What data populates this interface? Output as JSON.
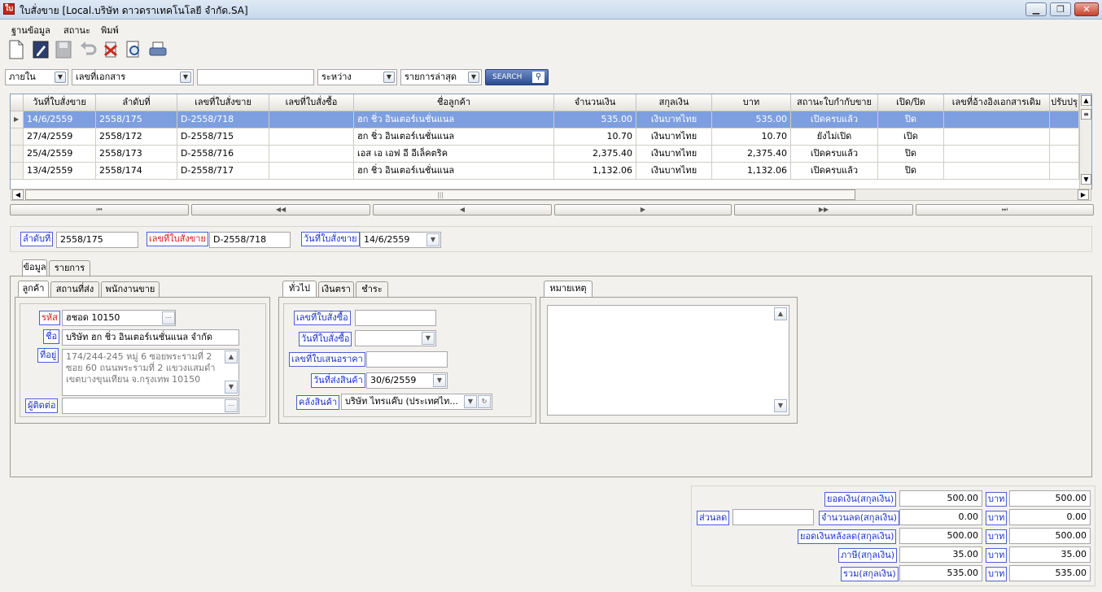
{
  "window": {
    "title": "ใบสั่งขาย [Local.บริษัท ดาวดราเทคโนโลยี จำกัด.SA]",
    "app_icon": "ใบ"
  },
  "menu": [
    "ฐานข้อมูล",
    "สถานะ",
    "พิมพ์"
  ],
  "search": {
    "scope": "ภายใน",
    "field": "เลขที่เอกสาร",
    "text": "",
    "operator": "ระหว่าง",
    "order": "รายการล่าสุด",
    "button": "SEARCH"
  },
  "grid": {
    "headers": [
      "วันที่ใบสั่งขาย",
      "ลำดับที่",
      "เลขที่ใบสั่งขาย",
      "เลขที่ใบสั่งซื้อ",
      "ชื่อลูกค้า",
      "จำนวนเงิน",
      "สกุลเงิน",
      "บาท",
      "สถานะใบกำกับขาย",
      "เปิด/ปิด",
      "เลขที่อ้างอิงเอกสารเดิม",
      "ปรับปรุ"
    ],
    "rows": [
      [
        "14/6/2559",
        "2558/175",
        "D-2558/718",
        "",
        "ฮก ชิ่ว อินเตอร์เนชั่นแนล",
        "535.00",
        "เงินบาทไทย",
        "535.00",
        "เปิดครบแล้ว",
        "ปิด",
        "",
        ""
      ],
      [
        "27/4/2559",
        "2558/172",
        "D-2558/715",
        "",
        "ฮก ชิ่ว อินเตอร์เนชั่นแนล",
        "10.70",
        "เงินบาทไทย",
        "10.70",
        "ยังไม่เปิด",
        "เปิด",
        "",
        ""
      ],
      [
        "25/4/2559",
        "2558/173",
        "D-2558/716",
        "",
        "เอส เอ เอฟ อี อีเล็คตริค",
        "2,375.40",
        "เงินบาทไทย",
        "2,375.40",
        "เปิดครบแล้ว",
        "ปิด",
        "",
        ""
      ],
      [
        "13/4/2559",
        "2558/174",
        "D-2558/717",
        "",
        "ฮก ชิ่ว อินเตอร์เนชั่นแนล",
        "1,132.06",
        "เงินบาทไทย",
        "1,132.06",
        "เปิดครบแล้ว",
        "ปิด",
        "",
        ""
      ]
    ]
  },
  "nav": [
    "first-icon",
    "fast-prev-icon",
    "prev-icon",
    "next-icon",
    "fast-next-icon",
    "last-icon"
  ],
  "doc": {
    "seq_label": "ลำดับที่",
    "seq": "2558/175",
    "so_label": "เลขที่ใบสั่งขาย",
    "so": "D-2558/718",
    "date_label": "วันที่ใบสั่งขาย",
    "date": "14/6/2559"
  },
  "tabs_main": [
    "ข้อมูล",
    "รายการ"
  ],
  "tabs_customer": [
    "ลูกค้า",
    "สถานที่ส่ง",
    "พนักงานขาย"
  ],
  "customer": {
    "code_label": "รหัส",
    "code": "ฮชอด 10150",
    "name_label": "ชื่อ",
    "name": "บริษัท ฮก ชิ่ว อินเตอร์เนชั่นแนล จำกัด",
    "addr_label": "ที่อยู่",
    "addr1": "174/244-245  หมู่ 6  ซอยพระรามที่ 2",
    "addr2": "ซอย 60  ถนนพระรามที่ 2 แขวงแสมดำ",
    "addr3": "เขตบางขุนเทียน จ.กรุงเทพ 10150",
    "contact_label": "ผู้ติดต่อ",
    "contact": ""
  },
  "tabs_general": [
    "ทั่วไป",
    "เงินตรา",
    "ชำระ"
  ],
  "general": {
    "po_label": "เลขที่ใบสั่งซื้อ",
    "po": "",
    "po_date_label": "วันที่ใบสั่งซื้อ",
    "po_date": "",
    "quote_label": "เลขที่ใบเสนอราคา",
    "quote": "",
    "ship_date_label": "วันที่ส่งสินค้า",
    "ship_date": "30/6/2559",
    "warehouse_label": "คลังสินค้า",
    "warehouse": "บริษัท ไทรแค๊บ (ประเทศไท..."
  },
  "notes": {
    "tab": "หมายเหตุ",
    "text": ""
  },
  "totals": {
    "discount_label": "ส่วนลด",
    "discount_input": "",
    "currency_unit": "บาท",
    "rows": [
      {
        "label": "ยอดเงิน(สกุลเงิน)",
        "value": "500.00",
        "thb": "500.00"
      },
      {
        "label": "จำนวนลด(สกุลเงิน)",
        "value": "0.00",
        "thb": "0.00"
      },
      {
        "label": "ยอดเงินหลังลด(สกุลเงิน)",
        "value": "500.00",
        "thb": "500.00"
      },
      {
        "label": "ภาษี(สกุลเงิน)",
        "value": "35.00",
        "thb": "35.00"
      },
      {
        "label": "รวม(สกุลเงิน)",
        "value": "535.00",
        "thb": "535.00"
      }
    ]
  },
  "colors": {
    "selection": "#7d9fe0",
    "label_blue": "#1a2fd0",
    "label_red": "#d21a1a"
  }
}
